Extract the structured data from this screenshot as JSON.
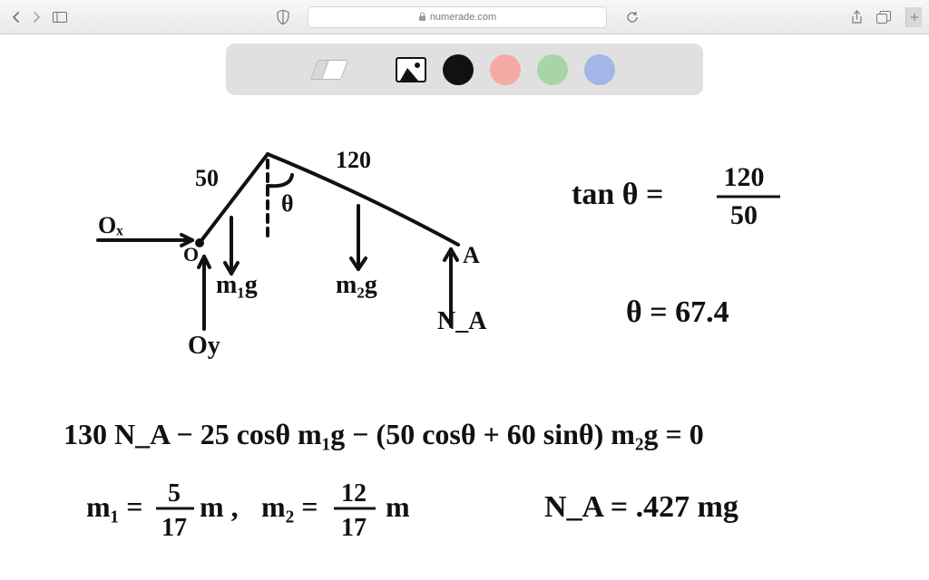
{
  "browser": {
    "url": "numerade.com"
  },
  "toolbar": {
    "tool_eraser": "eraser",
    "tool_image": "image",
    "color_black": "black",
    "color_red": "red",
    "color_green": "green",
    "color_blue": "blue"
  },
  "diagram": {
    "label_50": "50",
    "label_120": "120",
    "label_theta": "θ",
    "label_Ox": "Oₓ",
    "label_O": "O",
    "label_Oy": "Oy",
    "label_m1g": "m₁g",
    "label_m2g": "m₂g",
    "label_A": "A",
    "label_NA": "N_A"
  },
  "equations": {
    "tan_lhs": "tan θ =",
    "tan_num": "120",
    "tan_den": "50",
    "theta_val": "θ = 67.4",
    "torque": "130 N_A − 25 cosθ m₁g − (50 cosθ + 60 sinθ) m₂g = 0",
    "m1_lhs": "m₁ =",
    "m1_num": "5",
    "m1_den": "17",
    "m1_suffix": "m ,",
    "m2_lhs": "m₂ =",
    "m2_num": "12",
    "m2_den": "17",
    "m2_suffix": "m",
    "NA_result": "N_A = .427 mg"
  }
}
